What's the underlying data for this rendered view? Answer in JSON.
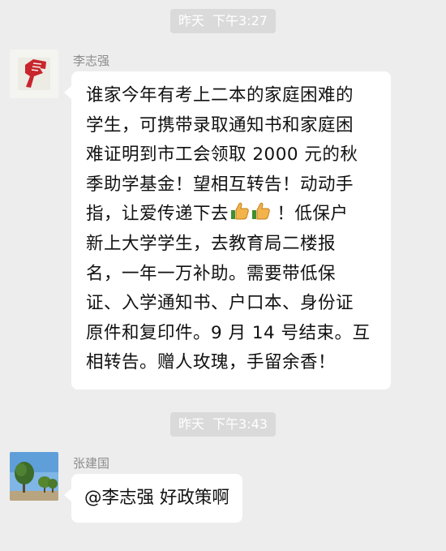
{
  "messages": [
    {
      "timestamp": {
        "day": "昨天",
        "time": "下午3:27"
      },
      "sender": "李志强",
      "avatar": "red-fist-logo",
      "lines": [
        {
          "text": "谁家今年有考上二本的家庭困难的"
        },
        {
          "text": "学生，可携带录取通知书和家庭困"
        },
        {
          "text": "难证明到市工会领取 2000 元的秋"
        },
        {
          "text": "季助学基金！望相互转告！动动手"
        },
        {
          "text": "指，让爱传递下去",
          "emoji": "thumbs-up-icon",
          "emoji_count": 2,
          "after": " ！低保户"
        },
        {
          "text": "新上大学学生，去教育局二楼报"
        },
        {
          "text": "名，一年一万补助。需要带低保"
        },
        {
          "text": "证、入学通知书、户口本、身份证"
        },
        {
          "text": "原件和复印件。9 月 14 号结束。互"
        },
        {
          "text": "相转告。赠人玫瑰，手留余香！"
        }
      ]
    },
    {
      "timestamp": {
        "day": "昨天",
        "time": "下午3:43"
      },
      "sender": "张建国",
      "avatar": "trees-photo",
      "text": "@李志强  好政策啊"
    }
  ],
  "colors": {
    "background": "#ededed",
    "bubble": "#ffffff",
    "badge": "#dadada",
    "name": "#8c8c8c"
  }
}
